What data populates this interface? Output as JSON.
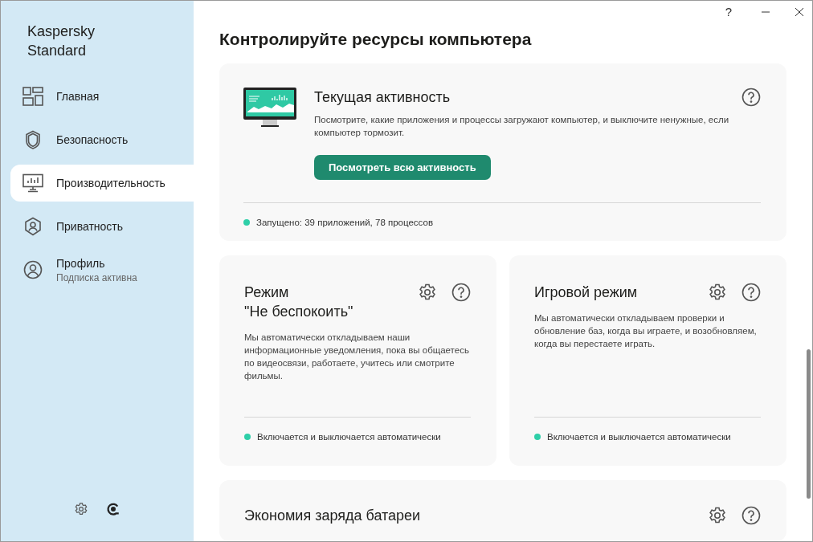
{
  "app": {
    "name": "Kaspersky\nStandard"
  },
  "window": {
    "help": "?"
  },
  "sidebar": {
    "items": [
      {
        "kind": "home",
        "label": "Главная",
        "selected": false
      },
      {
        "kind": "security",
        "label": "Безопасность",
        "selected": false
      },
      {
        "kind": "performance",
        "label": "Производительность",
        "selected": true
      },
      {
        "kind": "privacy",
        "label": "Приватность",
        "selected": false
      },
      {
        "kind": "profile",
        "label": "Профиль",
        "sublabel": "Подписка активна",
        "selected": false
      }
    ]
  },
  "page": {
    "title": "Контролируйте ресурсы компьютера"
  },
  "activity_card": {
    "title": "Текущая активность",
    "description": "Посмотрите, какие приложения и процессы загружают компьютер, и выключите ненужные, если компьютер тормозит.",
    "button": "Посмотреть всю активность",
    "status": "Запущено: 39 приложений, 78 процессов",
    "status_on": true
  },
  "mode_cards": [
    {
      "title": "Режим\n\"Не беспокоить\"",
      "description": "Мы автоматически откладываем наши информационные уведомления, пока вы общаетесь по видеосвязи, работаете, учитесь или смотрите фильмы.",
      "status": "Включается и выключается автоматически",
      "status_on": true
    },
    {
      "title": "Игровой режим",
      "description": "Мы автоматически откладываем проверки и обновление баз, когда вы играете, и возобновляем, когда вы перестаете играть.",
      "status": "Включается и выключается автоматически",
      "status_on": true
    }
  ],
  "battery_card": {
    "title": "Экономия заряда батареи"
  }
}
